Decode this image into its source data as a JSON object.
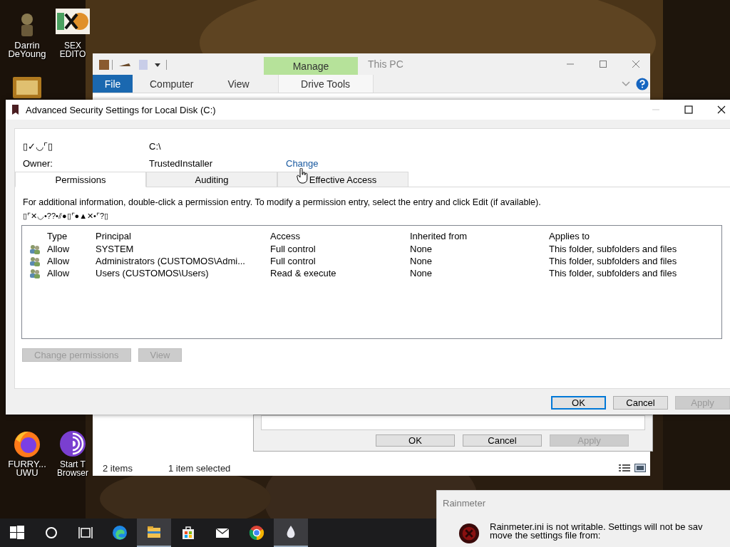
{
  "desktop": {
    "icons": [
      {
        "kind": "bust",
        "label": "Darrin DeYoung"
      },
      {
        "kind": "hxd",
        "label": "SEX EDITO"
      },
      {
        "kind": "frame"
      },
      {
        "kind": "firefox",
        "label": "FURRY... UWU"
      },
      {
        "kind": "tor",
        "label": "Start T Browser"
      }
    ]
  },
  "explorer": {
    "title": "This PC",
    "context_group": "Manage",
    "tabs": [
      {
        "label": "File",
        "kind": "file"
      },
      {
        "label": "Computer",
        "kind": "tab"
      },
      {
        "label": "View",
        "kind": "tab"
      },
      {
        "label": "Drive Tools",
        "kind": "context"
      }
    ],
    "status_bar": {
      "items": "2 items",
      "selected": "1 item selected"
    }
  },
  "properties_dialog": {
    "buttons": [
      {
        "label": "OK",
        "disabled": false
      },
      {
        "label": "Cancel",
        "disabled": false
      },
      {
        "label": "Apply",
        "disabled": true
      }
    ]
  },
  "dialog": {
    "title": "Advanced Security Settings for Local Disk (C:)",
    "name_label": "▯✓◡⌜▯",
    "name_value": "C:\\",
    "owner_label": "Owner:",
    "owner_value": "TrustedInstaller",
    "owner_link": "Change",
    "tabs": [
      {
        "label": "Permissions",
        "selected": true
      },
      {
        "label": "Auditing",
        "selected": false
      },
      {
        "label": "Effective Access",
        "selected": false
      }
    ],
    "info": "For additional information, double-click a permission entry. To modify a permission entry, select the entry and click Edit (if available).",
    "garbled_line": "▯⌜✕◡•??•⫽●▯⌜●▲✕•⌜?▯",
    "table": {
      "columns": [
        "Type",
        "Principal",
        "Access",
        "Inherited from",
        "Applies to"
      ],
      "rows": [
        [
          "Allow",
          "SYSTEM",
          "Full control",
          "None",
          "This folder, subfolders and files"
        ],
        [
          "Allow",
          "Administrators (CUSTOMOS\\Admi...",
          "Full control",
          "None",
          "This folder, subfolders and files"
        ],
        [
          "Allow",
          "Users (CUSTOMOS\\Users)",
          "Read & execute",
          "None",
          "This folder, subfolders and files"
        ]
      ]
    },
    "buttons": [
      {
        "label": "Change permissions",
        "disabled": true
      },
      {
        "label": "View",
        "disabled": true
      }
    ],
    "footer_buttons": [
      {
        "label": "OK",
        "disabled": false,
        "focused": true
      },
      {
        "label": "Cancel",
        "disabled": false,
        "focused": false
      },
      {
        "label": "Apply",
        "disabled": true,
        "focused": false
      }
    ]
  },
  "rainmeter": {
    "title": "Rainmeter",
    "lines": [
      "Rainmeter.ini is not writable. Settings will not be sav",
      "move the settings file from:"
    ]
  },
  "taskbar": {
    "items": [
      {
        "kind": "start",
        "active": false
      },
      {
        "kind": "search",
        "active": false
      },
      {
        "kind": "taskview",
        "active": false
      },
      {
        "kind": "edge",
        "active": false
      },
      {
        "kind": "folder",
        "active": true
      },
      {
        "kind": "store",
        "active": false
      },
      {
        "kind": "mail",
        "active": false
      },
      {
        "kind": "chrome",
        "active": false
      },
      {
        "kind": "drop",
        "active": true
      }
    ]
  }
}
